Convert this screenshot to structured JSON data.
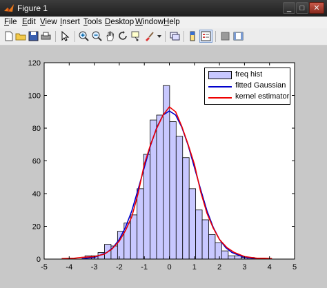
{
  "window": {
    "title": "Figure 1",
    "minimize": "_",
    "maximize": "□",
    "close": "✕"
  },
  "menubar": [
    {
      "label": "File",
      "mnemonic": "F",
      "rest": "ile"
    },
    {
      "label": "Edit",
      "mnemonic": "E",
      "rest": "dit"
    },
    {
      "label": "View",
      "mnemonic": "V",
      "rest": "iew"
    },
    {
      "label": "Insert",
      "mnemonic": "I",
      "rest": "nsert"
    },
    {
      "label": "Tools",
      "mnemonic": "T",
      "rest": "ools"
    },
    {
      "label": "Desktop",
      "mnemonic": "D",
      "rest": "esktop"
    },
    {
      "label": "Window",
      "mnemonic": "W",
      "rest": "indow"
    },
    {
      "label": "Help",
      "mnemonic": "H",
      "rest": "elp"
    }
  ],
  "toolbar": [
    "new-figure-icon",
    "open-file-icon",
    "save-icon",
    "print-icon",
    "edit-plot-icon",
    "zoom-in-icon",
    "zoom-out-icon",
    "pan-icon",
    "rotate-3d-icon",
    "data-cursor-icon",
    "brush-icon",
    "link-plot-icon",
    "insert-colorbar-icon",
    "insert-legend-icon",
    "hide-plot-tools-icon",
    "show-plot-tools-icon"
  ],
  "colors": {
    "bar_fill": "#c8c8ff",
    "bar_edge": "#000000",
    "gaussian": "#0000cc",
    "kernel": "#ee0000"
  },
  "chart_data": {
    "type": "bar",
    "x_centers": [
      -3.76,
      -3.5,
      -3.24,
      -2.98,
      -2.72,
      -2.46,
      -2.2,
      -1.94,
      -1.68,
      -1.42,
      -1.16,
      -0.9,
      -0.64,
      -0.38,
      -0.12,
      0.14,
      0.4,
      0.66,
      0.92,
      1.18,
      1.44,
      1.7,
      1.96,
      2.22,
      2.48,
      2.74,
      3.0,
      3.26,
      3.52,
      3.78
    ],
    "series": [
      {
        "name": "freq hist",
        "type": "bar",
        "values": [
          0,
          0,
          2,
          2,
          4,
          9,
          8,
          17,
          22,
          27,
          43,
          64,
          85,
          88,
          106,
          84,
          75,
          62,
          43,
          30,
          24,
          15,
          10,
          5,
          2,
          2,
          1,
          1,
          0,
          0
        ]
      },
      {
        "name": "fitted Gaussian",
        "type": "line",
        "x": [
          -3.5,
          -3.0,
          -2.5,
          -2.25,
          -2.0,
          -1.75,
          -1.5,
          -1.25,
          -1.0,
          -0.75,
          -0.5,
          -0.25,
          0.0,
          0.25,
          0.5,
          0.75,
          1.0,
          1.25,
          1.5,
          1.75,
          2.0,
          2.25,
          2.5,
          3.0,
          3.5
        ],
        "y": [
          0.2,
          1.0,
          4.0,
          7.0,
          12.0,
          19.5,
          29.5,
          42.5,
          56.0,
          69.5,
          80.5,
          88.0,
          90.5,
          88.0,
          80.5,
          69.5,
          56.0,
          42.5,
          29.5,
          19.5,
          12.0,
          7.0,
          4.0,
          1.0,
          0.2
        ]
      },
      {
        "name": "kernel estimator",
        "type": "line",
        "x": [
          -4.3,
          -3.8,
          -3.5,
          -3.0,
          -2.6,
          -2.3,
          -2.0,
          -1.75,
          -1.5,
          -1.25,
          -1.0,
          -0.75,
          -0.5,
          -0.25,
          0.0,
          0.25,
          0.5,
          0.75,
          1.0,
          1.25,
          1.5,
          1.75,
          2.0,
          2.3,
          2.6,
          3.0,
          3.5,
          3.8,
          4.1
        ],
        "y": [
          0.3,
          0.5,
          1.0,
          1.5,
          3.0,
          6.0,
          11.0,
          17.5,
          26.0,
          40.0,
          58.0,
          70.0,
          80.0,
          88.0,
          93.0,
          90.0,
          81.0,
          70.0,
          58.0,
          41.0,
          28.0,
          19.0,
          12.0,
          7.0,
          4.0,
          1.5,
          0.5,
          0.5,
          0.3
        ]
      }
    ],
    "xlim": [
      -5,
      5
    ],
    "ylim": [
      0,
      120
    ],
    "xticks": [
      "-5",
      "-4",
      "-3",
      "-2",
      "-1",
      "0",
      "1",
      "2",
      "3",
      "4",
      "5"
    ],
    "yticks": [
      "0",
      "20",
      "40",
      "60",
      "80",
      "100",
      "120"
    ],
    "title": "",
    "xlabel": "",
    "ylabel": "",
    "legend_position": "top-right",
    "legend": [
      "freq hist",
      "fitted Gaussian",
      "kernel estimator"
    ]
  }
}
